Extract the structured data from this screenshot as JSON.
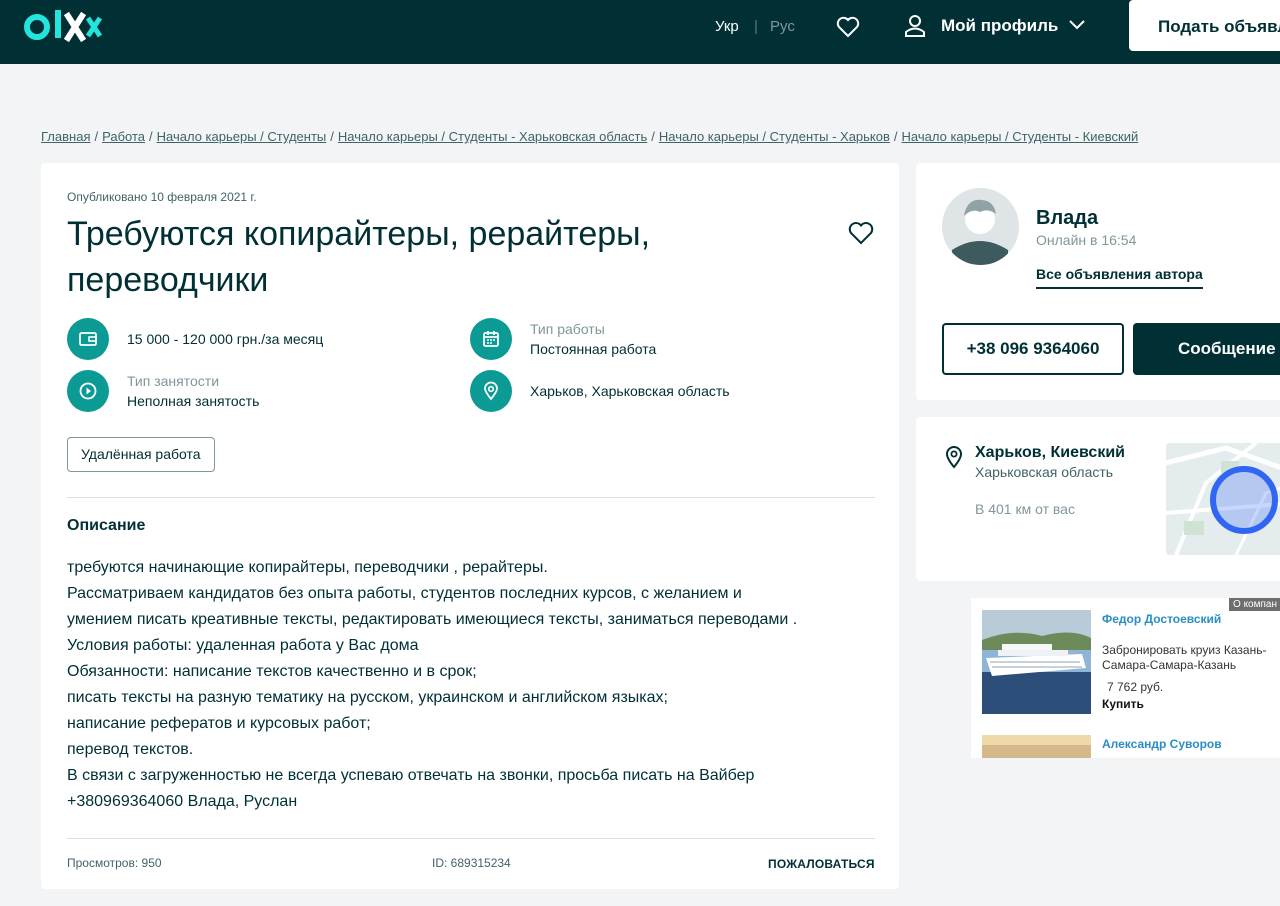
{
  "header": {
    "logo_text": "olx",
    "lang_ukr": "Укр",
    "lang_sep": "|",
    "lang_rus": "Рус",
    "profile_label": "Мой профиль",
    "post_button": "Подать объявл"
  },
  "breadcrumbs": [
    "Главная",
    "Работа",
    "Начало карьеры / Студенты",
    "Начало карьеры / Студенты - Харьковская область",
    "Начало карьеры / Студенты - Харьков",
    "Начало карьеры / Студенты - Киевский"
  ],
  "listing": {
    "published": "Опубликовано 10 февраля 2021 г.",
    "title": "Требуются копирайтеры, рерайтеры, переводчики",
    "params": {
      "salary": "15 000 - 120 000 грн./за месяц",
      "work_type_label": "Тип работы",
      "work_type_value": "Постоянная работа",
      "employment_label": "Тип занятости",
      "employment_value": "Неполная занятость",
      "location": "Харьков, Харьковская область"
    },
    "tag": "Удалённая работа",
    "description_heading": "Описание",
    "description_lines": [
      "требуются начинающие копирайтеры, переводчики , рерайтеры.",
      "Рассматриваем кандидатов без опыта работы, студентов последних курсов, с желанием и",
      "умением писать креативные тексты, редактировать имеющиеся тексты, заниматься переводами .",
      "Условия работы: удаленная работа у Вас дома",
      "Обязанности: написание текстов качественно и в срок;",
      "писать тексты на разную тематику на русском, украинском и английском языках;",
      "написание рефератов и курсовых работ;",
      "перевод текстов.",
      "В связи с загруженностью не всегда успеваю отвечать на звонки, просьба писать на Вайбер",
      "+380969364060 Влада, Руслан"
    ],
    "views": "Просмотров: 950",
    "id": "ID: 689315234",
    "report": "ПОЖАЛОВАТЬСЯ"
  },
  "seller": {
    "name": "Влада",
    "online": "Онлайн в 16:54",
    "all_ads": "Все объявления автора",
    "phone": "+38 096 9364060",
    "message": "Сообщение"
  },
  "location": {
    "city": "Харьков, Киевский",
    "region": "Харьковская область",
    "distance": "В 401 км от вас"
  },
  "ad": {
    "badge": "О компан",
    "item1_title": "Федор Достоевский",
    "item1_text": "Забронировать круиз Казань-Самара-Самара-Казань",
    "item1_price": "7 762 руб.",
    "item1_buy": "Купить",
    "item2_title": "Александр Суворов"
  },
  "colors": {
    "header_bg": "#002f34",
    "brand_teal": "#23e5db",
    "icon_bg": "#0c9b94",
    "page_bg": "#f2f4f5",
    "text_dark": "#002f34",
    "link_blue": "#2a8dc4"
  }
}
